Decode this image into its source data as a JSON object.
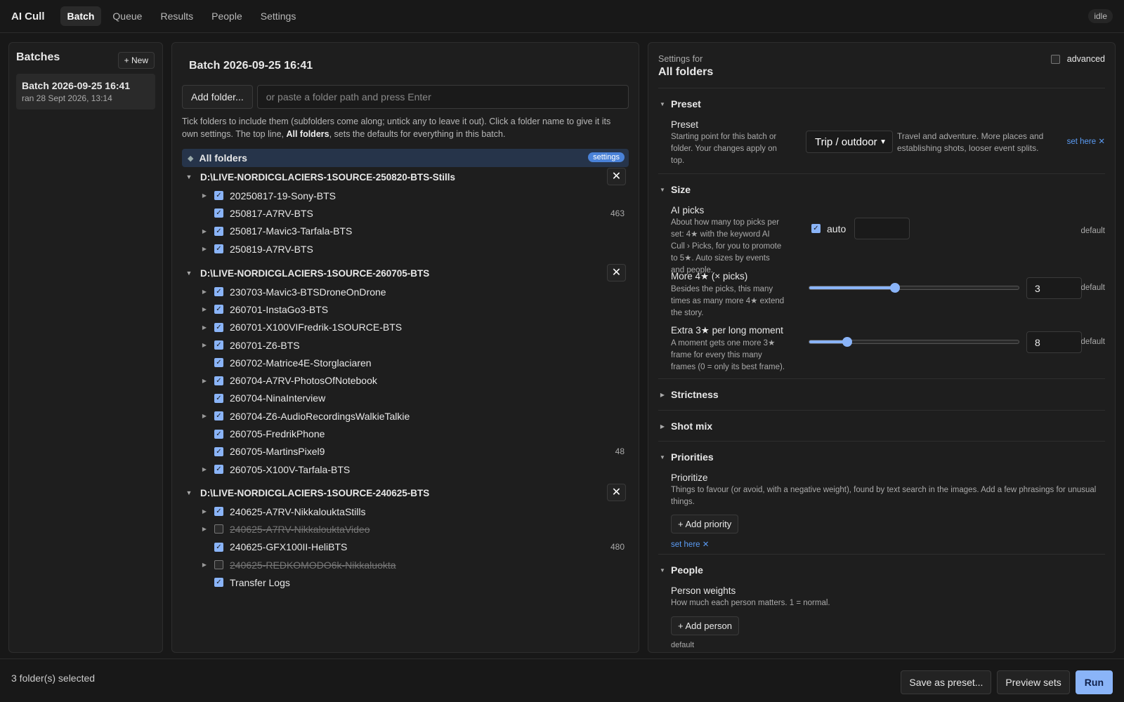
{
  "app": {
    "name": "AI Cull",
    "status": "idle"
  },
  "nav": {
    "tabs": [
      {
        "label": "Batch",
        "active": true
      },
      {
        "label": "Queue"
      },
      {
        "label": "Results"
      },
      {
        "label": "People"
      },
      {
        "label": "Settings"
      }
    ]
  },
  "batches": {
    "title": "Batches",
    "new_label": "+ New",
    "items": [
      {
        "name": "Batch 2026-09-25 16:41",
        "ran": "ran 28 Sept 2026, 13:14"
      }
    ]
  },
  "main": {
    "title": "Batch 2026-09-25 16:41",
    "add_folder_label": "Add folder...",
    "path_placeholder": "or paste a folder path and press Enter",
    "help_pre": "Tick folders to include them (subfolders come along; untick any to leave it out). Click a folder name to give it its own settings. The top line, ",
    "help_bold": "All folders",
    "help_post": ", sets the defaults for everything in this batch.",
    "all_folders": {
      "label": "All folders",
      "badge": "settings"
    },
    "close_symbol": "✕",
    "groups": [
      {
        "path": "D:\\LIVE-NORDICGLACIERS-1SOURCE-250820-BTS-Stills",
        "folders": [
          {
            "name": "20250817-19-Sony-BTS",
            "checked": true,
            "expandable": true
          },
          {
            "name": "250817-A7RV-BTS",
            "checked": true,
            "expandable": false,
            "count": "463"
          },
          {
            "name": "250817-Mavic3-Tarfala-BTS",
            "checked": true,
            "expandable": true
          },
          {
            "name": "250819-A7RV-BTS",
            "checked": true,
            "expandable": true
          }
        ]
      },
      {
        "path": "D:\\LIVE-NORDICGLACIERS-1SOURCE-260705-BTS",
        "folders": [
          {
            "name": "230703-Mavic3-BTSDroneOnDrone",
            "checked": true,
            "expandable": true
          },
          {
            "name": "260701-InstaGo3-BTS",
            "checked": true,
            "expandable": true
          },
          {
            "name": "260701-X100VIFredrik-1SOURCE-BTS",
            "checked": true,
            "expandable": true
          },
          {
            "name": "260701-Z6-BTS",
            "checked": true,
            "expandable": true
          },
          {
            "name": "260702-Matrice4E-Storglaciaren",
            "checked": true,
            "expandable": false
          },
          {
            "name": "260704-A7RV-PhotosOfNotebook",
            "checked": true,
            "expandable": true
          },
          {
            "name": "260704-NinaInterview",
            "checked": true,
            "expandable": false
          },
          {
            "name": "260704-Z6-AudioRecordingsWalkieTalkie",
            "checked": true,
            "expandable": true
          },
          {
            "name": "260705-FredrikPhone",
            "checked": true,
            "expandable": false
          },
          {
            "name": "260705-MartinsPixel9",
            "checked": true,
            "expandable": false,
            "count": "48"
          },
          {
            "name": "260705-X100V-Tarfala-BTS",
            "checked": true,
            "expandable": true
          }
        ]
      },
      {
        "path": "D:\\LIVE-NORDICGLACIERS-1SOURCE-240625-BTS",
        "folders": [
          {
            "name": "240625-A7RV-NikkalouktaStills",
            "checked": true,
            "expandable": true
          },
          {
            "name": "240625-A7RV-NikkalouktaVideo",
            "checked": false,
            "expandable": true
          },
          {
            "name": "240625-GFX100II-HeliBTS",
            "checked": true,
            "expandable": false,
            "count": "480"
          },
          {
            "name": "240625-REDKOMODO6k-Nikkaluokta",
            "checked": false,
            "expandable": true
          },
          {
            "name": "Transfer Logs",
            "checked": true,
            "expandable": false
          }
        ]
      }
    ]
  },
  "settings": {
    "for_label": "Settings for",
    "title": "All folders",
    "advanced_label": "advanced",
    "preset": {
      "title": "Preset",
      "label": "Preset",
      "desc": "Starting point for this batch or folder. Your changes apply on top.",
      "value": "Trip / outdoor",
      "value_desc": "Travel and adventure. More places and establishing shots, looser event splits.",
      "set_here": "set here ✕"
    },
    "size": {
      "title": "Size",
      "ai_picks": {
        "label": "AI picks",
        "desc": "About how many top picks per set: 4★ with the keyword AI Cull › Picks, for you to promote to 5★. Auto sizes by events and people.",
        "auto_label": "auto",
        "auto_checked": true,
        "value": "",
        "status": "default"
      },
      "more4": {
        "label": "More 4★ (× picks)",
        "desc": "Besides the picks, this many times as many more 4★ extend the story.",
        "value": "3",
        "slider_fraction": 0.41,
        "status": "default"
      },
      "extra3": {
        "label": "Extra 3★ per long moment",
        "desc": "A moment gets one more 3★ frame for every this many frames (0 = only its best frame).",
        "value": "8",
        "slider_fraction": 0.18,
        "status": "default"
      }
    },
    "strictness": {
      "title": "Strictness"
    },
    "shot_mix": {
      "title": "Shot mix"
    },
    "priorities": {
      "title": "Priorities",
      "label": "Prioritize",
      "desc": "Things to favour (or avoid, with a negative weight), found by text search in the images. Add a few phrasings for unusual things.",
      "add_label": "+ Add priority",
      "set_here": "set here ✕"
    },
    "people": {
      "title": "People",
      "label": "Person weights",
      "desc": "How much each person matters. 1 = normal.",
      "add_label": "+ Add person",
      "status": "default"
    }
  },
  "footer": {
    "selected": "3 folder(s) selected",
    "save_preset": "Save as preset...",
    "preview": "Preview sets",
    "run": "Run"
  },
  "colors": {
    "accent": "#8ab4f8",
    "link": "#5b9cf5",
    "badge": "#4a82d8",
    "all_row": "#26344a"
  }
}
